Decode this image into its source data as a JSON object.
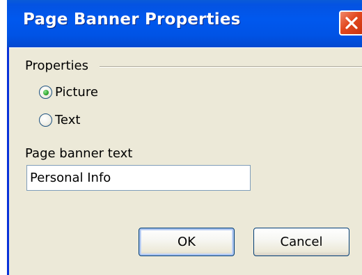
{
  "window": {
    "title": "Page Banner Properties"
  },
  "properties_group": {
    "label": "Properties",
    "options": [
      {
        "label": "Picture",
        "selected": true
      },
      {
        "label": "Text",
        "selected": false
      }
    ]
  },
  "banner_text": {
    "label": "Page banner text",
    "value": "Personal Info"
  },
  "buttons": {
    "ok": "OK",
    "cancel": "Cancel"
  },
  "colors": {
    "titlebar": "#0058ee",
    "close_button": "#e2481e",
    "dialog_background": "#ece9d8",
    "radio_selected": "#2fa62f"
  },
  "icons": {
    "close": "close-icon"
  }
}
